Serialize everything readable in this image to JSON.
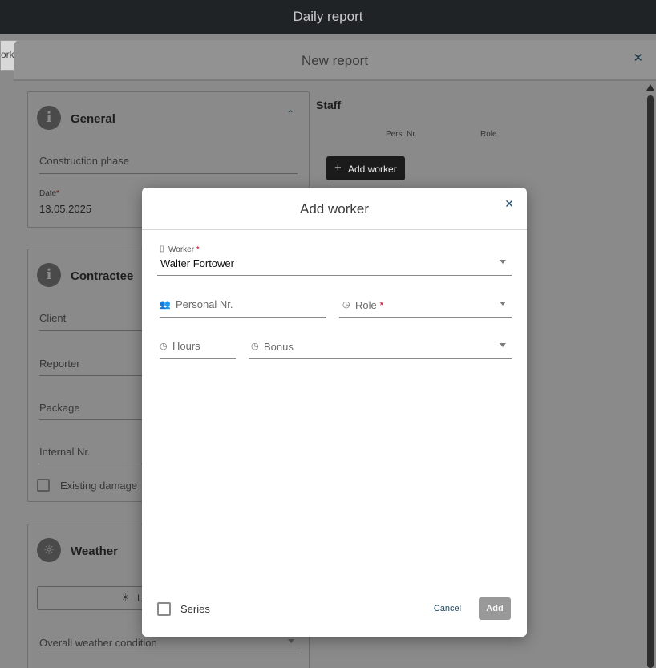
{
  "app": {
    "title": "Daily report",
    "peek_tab_label": "ork"
  },
  "sheet": {
    "title": "New report",
    "close_icon": "close-icon",
    "general": {
      "title": "General",
      "construction_phase_placeholder": "Construction phase",
      "date_label": "Date",
      "date_required": "*",
      "date_value": "13.05.2025"
    },
    "contractee": {
      "title": "Contractee",
      "client_placeholder": "Client",
      "reporter_placeholder": "Reporter",
      "package_placeholder": "Package",
      "internal_nr_placeholder": "Internal Nr.",
      "existing_damage_label": "Existing damage"
    },
    "weather": {
      "title": "Weather",
      "button_label": "L",
      "overall_placeholder": "Overall weather condition"
    },
    "staff": {
      "title": "Staff",
      "columns": [
        "Pers. Nr.",
        "Role"
      ],
      "add_worker_label": "Add worker"
    }
  },
  "modal": {
    "title": "Add worker",
    "worker": {
      "label": "Worker",
      "required": "*",
      "value": "Walter Fortower"
    },
    "personal_nr": {
      "placeholder": "Personal Nr."
    },
    "role": {
      "placeholder": "Role",
      "required": "*"
    },
    "hours": {
      "placeholder": "Hours"
    },
    "bonus": {
      "placeholder": "Bonus"
    },
    "series_label": "Series",
    "cancel_label": "Cancel",
    "add_label": "Add"
  }
}
